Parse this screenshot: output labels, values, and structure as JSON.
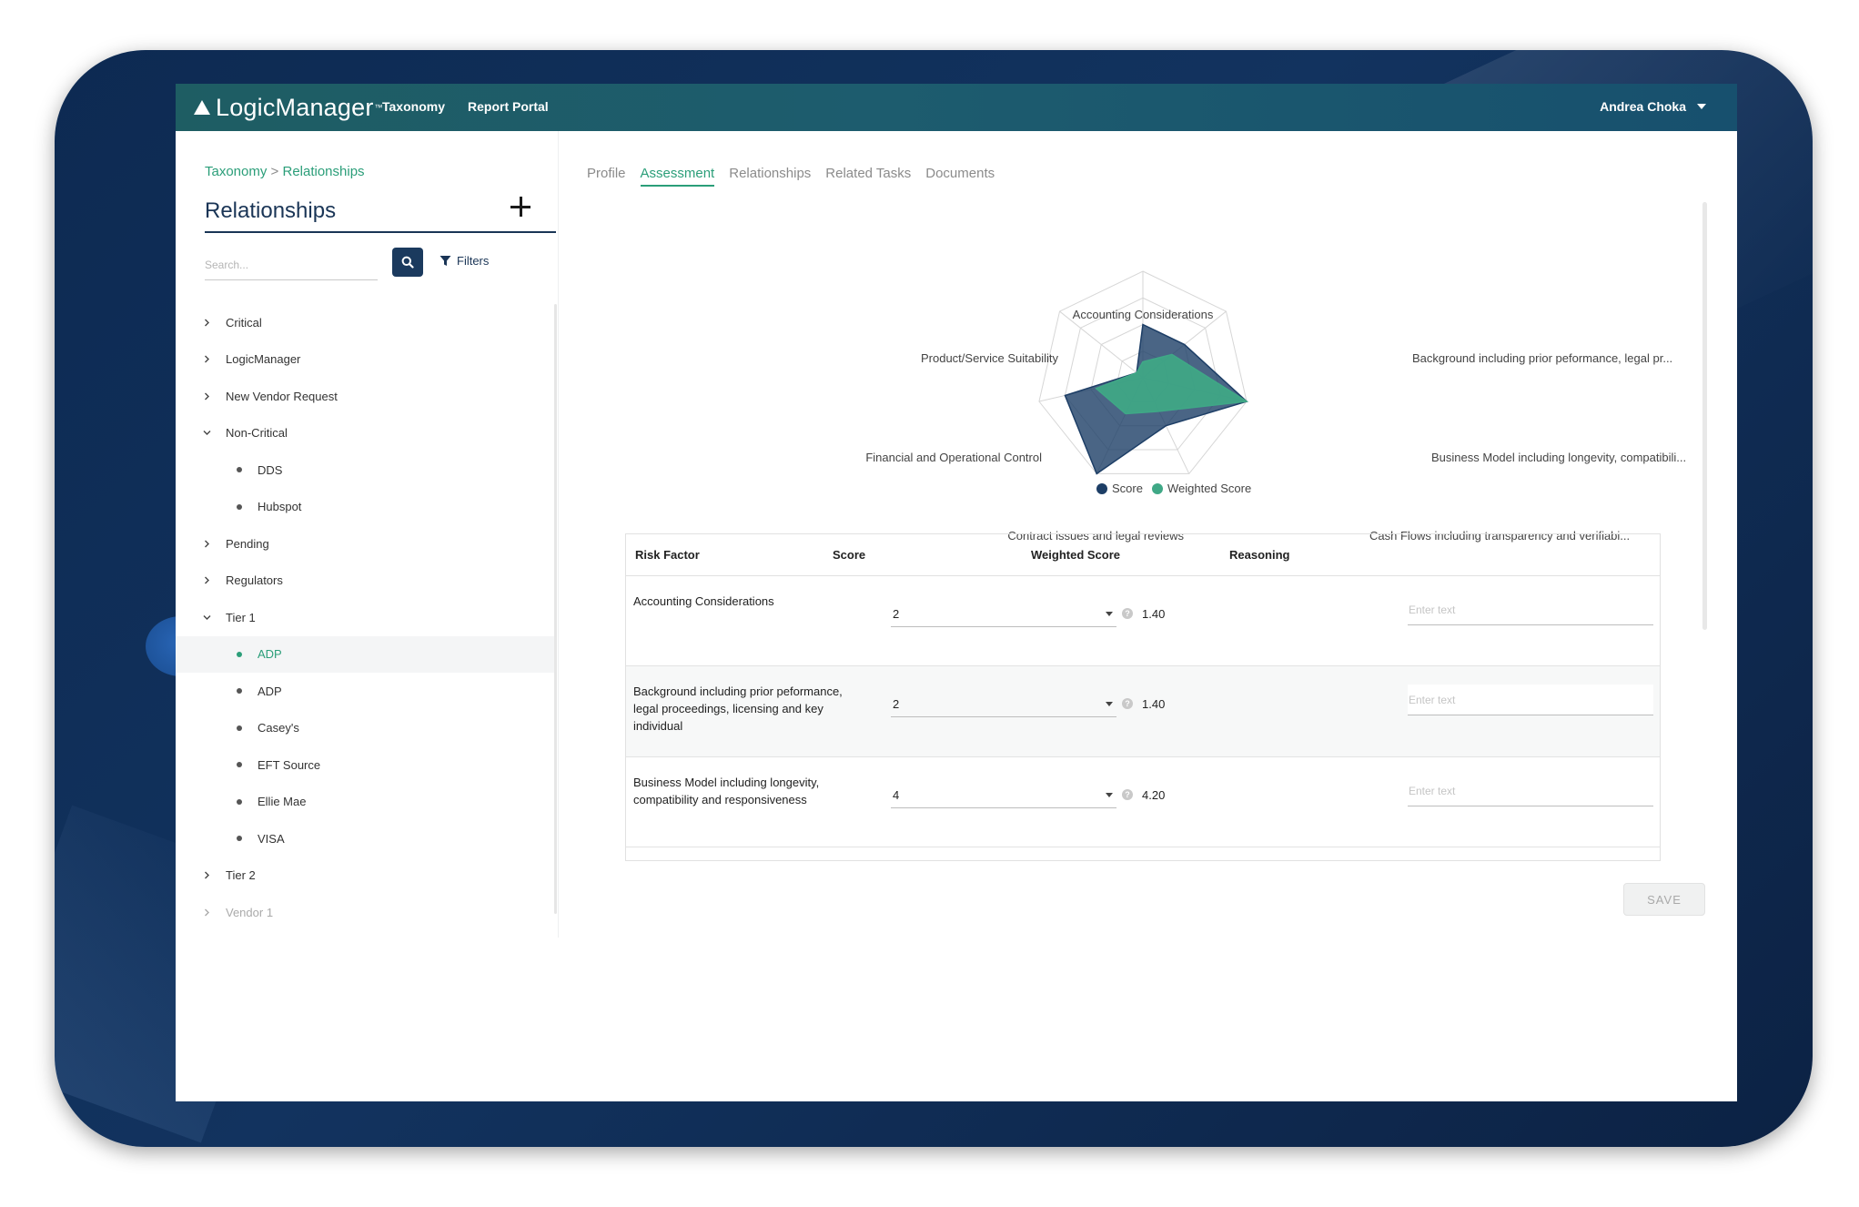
{
  "app": {
    "logo_text": "LogicManager",
    "logo_tm": "™",
    "nav": [
      "Taxonomy",
      "Report Portal"
    ],
    "user_name": "Andrea Choka"
  },
  "sidebar": {
    "breadcrumb": {
      "parent": "Taxonomy",
      "separator": ">",
      "current": "Relationships"
    },
    "title": "Relationships",
    "search_placeholder": "Search...",
    "filters_label": "Filters",
    "tree": [
      {
        "label": "Critical",
        "level": 0,
        "expanded": false
      },
      {
        "label": "LogicManager",
        "level": 0,
        "expanded": false
      },
      {
        "label": "New Vendor Request",
        "level": 0,
        "expanded": false
      },
      {
        "label": "Non-Critical",
        "level": 0,
        "expanded": true
      },
      {
        "label": "DDS",
        "level": 1
      },
      {
        "label": "Hubspot",
        "level": 1
      },
      {
        "label": "Pending",
        "level": 0,
        "expanded": false
      },
      {
        "label": "Regulators",
        "level": 0,
        "expanded": false
      },
      {
        "label": "Tier 1",
        "level": 0,
        "expanded": true
      },
      {
        "label": "ADP",
        "level": 1,
        "selected": true
      },
      {
        "label": "ADP",
        "level": 1
      },
      {
        "label": "Casey's",
        "level": 1
      },
      {
        "label": "EFT Source",
        "level": 1
      },
      {
        "label": "Ellie Mae",
        "level": 1
      },
      {
        "label": "VISA",
        "level": 1
      },
      {
        "label": "Tier 2",
        "level": 0,
        "expanded": false
      },
      {
        "label": "Vendor 1",
        "level": 0,
        "expanded": false,
        "faded": true
      }
    ]
  },
  "tabs": [
    {
      "label": "Profile",
      "active": false
    },
    {
      "label": "Assessment",
      "active": true
    },
    {
      "label": "Relationships",
      "active": false
    },
    {
      "label": "Related Tasks",
      "active": false
    },
    {
      "label": "Documents",
      "active": false
    }
  ],
  "chart_data": {
    "type": "radar",
    "axes": [
      "Accounting Considerations",
      "Background including prior peformance, legal pr...",
      "Business Model including longevity, compatibili...",
      "Cash Flows including transparency and verifiabi...",
      "Contract issues and legal reviews",
      "Financial and Operational Control",
      "Product/Service Suitability"
    ],
    "rmax": 4,
    "rings": 4,
    "series": [
      {
        "name": "Score",
        "color": "#1d3e66",
        "values": [
          2,
          2,
          4,
          2,
          4,
          3,
          0.3
        ]
      },
      {
        "name": "Weighted Score",
        "color": "#3fa886",
        "values": [
          0.6,
          1.4,
          4.0,
          1.4,
          1.5,
          1.8,
          0.3
        ]
      }
    ],
    "legend": "bottom"
  },
  "table": {
    "headers": [
      "Risk Factor",
      "Score",
      "Weighted Score",
      "Reasoning"
    ],
    "reasoning_placeholder": "Enter text",
    "rows": [
      {
        "factor": "Accounting Considerations",
        "score": "2",
        "weighted": "1.40",
        "reasoning": ""
      },
      {
        "factor": "Background including prior peformance, legal proceedings, licensing and key individual",
        "score": "2",
        "weighted": "1.40",
        "reasoning": ""
      },
      {
        "factor": "Business Model including longevity, compatibility and responsiveness",
        "score": "4",
        "weighted": "4.20",
        "reasoning": ""
      }
    ]
  },
  "save_label": "SAVE",
  "colors": {
    "accent": "#2b9e79",
    "navy": "#1a3556",
    "topbar": "#1e5d63"
  }
}
